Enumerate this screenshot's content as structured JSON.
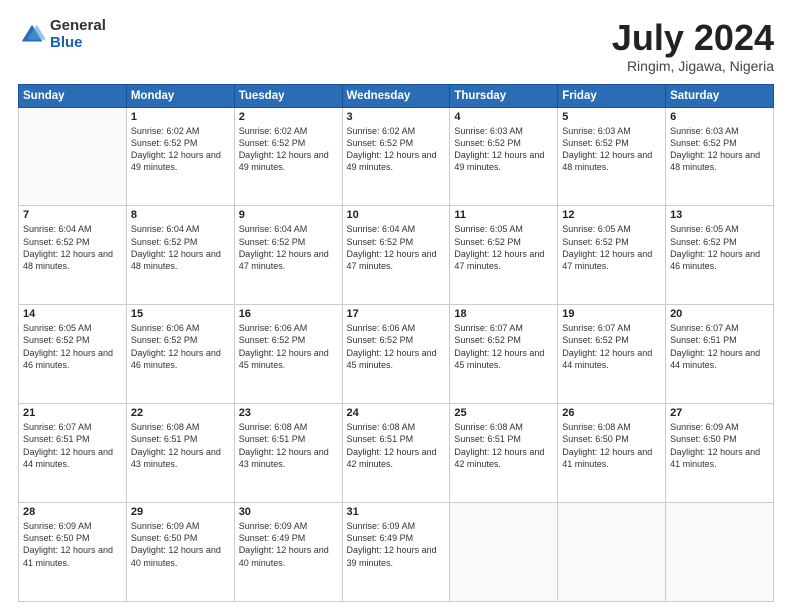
{
  "logo": {
    "general": "General",
    "blue": "Blue"
  },
  "title": "July 2024",
  "subtitle": "Ringim, Jigawa, Nigeria",
  "days_of_week": [
    "Sunday",
    "Monday",
    "Tuesday",
    "Wednesday",
    "Thursday",
    "Friday",
    "Saturday"
  ],
  "weeks": [
    [
      {
        "day": "",
        "info": ""
      },
      {
        "day": "1",
        "info": "Sunrise: 6:02 AM\nSunset: 6:52 PM\nDaylight: 12 hours and 49 minutes."
      },
      {
        "day": "2",
        "info": "Sunrise: 6:02 AM\nSunset: 6:52 PM\nDaylight: 12 hours and 49 minutes."
      },
      {
        "day": "3",
        "info": "Sunrise: 6:02 AM\nSunset: 6:52 PM\nDaylight: 12 hours and 49 minutes."
      },
      {
        "day": "4",
        "info": "Sunrise: 6:03 AM\nSunset: 6:52 PM\nDaylight: 12 hours and 49 minutes."
      },
      {
        "day": "5",
        "info": "Sunrise: 6:03 AM\nSunset: 6:52 PM\nDaylight: 12 hours and 48 minutes."
      },
      {
        "day": "6",
        "info": "Sunrise: 6:03 AM\nSunset: 6:52 PM\nDaylight: 12 hours and 48 minutes."
      }
    ],
    [
      {
        "day": "7",
        "info": "Sunrise: 6:04 AM\nSunset: 6:52 PM\nDaylight: 12 hours and 48 minutes."
      },
      {
        "day": "8",
        "info": "Sunrise: 6:04 AM\nSunset: 6:52 PM\nDaylight: 12 hours and 48 minutes."
      },
      {
        "day": "9",
        "info": "Sunrise: 6:04 AM\nSunset: 6:52 PM\nDaylight: 12 hours and 47 minutes."
      },
      {
        "day": "10",
        "info": "Sunrise: 6:04 AM\nSunset: 6:52 PM\nDaylight: 12 hours and 47 minutes."
      },
      {
        "day": "11",
        "info": "Sunrise: 6:05 AM\nSunset: 6:52 PM\nDaylight: 12 hours and 47 minutes."
      },
      {
        "day": "12",
        "info": "Sunrise: 6:05 AM\nSunset: 6:52 PM\nDaylight: 12 hours and 47 minutes."
      },
      {
        "day": "13",
        "info": "Sunrise: 6:05 AM\nSunset: 6:52 PM\nDaylight: 12 hours and 46 minutes."
      }
    ],
    [
      {
        "day": "14",
        "info": "Sunrise: 6:05 AM\nSunset: 6:52 PM\nDaylight: 12 hours and 46 minutes."
      },
      {
        "day": "15",
        "info": "Sunrise: 6:06 AM\nSunset: 6:52 PM\nDaylight: 12 hours and 46 minutes."
      },
      {
        "day": "16",
        "info": "Sunrise: 6:06 AM\nSunset: 6:52 PM\nDaylight: 12 hours and 45 minutes."
      },
      {
        "day": "17",
        "info": "Sunrise: 6:06 AM\nSunset: 6:52 PM\nDaylight: 12 hours and 45 minutes."
      },
      {
        "day": "18",
        "info": "Sunrise: 6:07 AM\nSunset: 6:52 PM\nDaylight: 12 hours and 45 minutes."
      },
      {
        "day": "19",
        "info": "Sunrise: 6:07 AM\nSunset: 6:52 PM\nDaylight: 12 hours and 44 minutes."
      },
      {
        "day": "20",
        "info": "Sunrise: 6:07 AM\nSunset: 6:51 PM\nDaylight: 12 hours and 44 minutes."
      }
    ],
    [
      {
        "day": "21",
        "info": "Sunrise: 6:07 AM\nSunset: 6:51 PM\nDaylight: 12 hours and 44 minutes."
      },
      {
        "day": "22",
        "info": "Sunrise: 6:08 AM\nSunset: 6:51 PM\nDaylight: 12 hours and 43 minutes."
      },
      {
        "day": "23",
        "info": "Sunrise: 6:08 AM\nSunset: 6:51 PM\nDaylight: 12 hours and 43 minutes."
      },
      {
        "day": "24",
        "info": "Sunrise: 6:08 AM\nSunset: 6:51 PM\nDaylight: 12 hours and 42 minutes."
      },
      {
        "day": "25",
        "info": "Sunrise: 6:08 AM\nSunset: 6:51 PM\nDaylight: 12 hours and 42 minutes."
      },
      {
        "day": "26",
        "info": "Sunrise: 6:08 AM\nSunset: 6:50 PM\nDaylight: 12 hours and 41 minutes."
      },
      {
        "day": "27",
        "info": "Sunrise: 6:09 AM\nSunset: 6:50 PM\nDaylight: 12 hours and 41 minutes."
      }
    ],
    [
      {
        "day": "28",
        "info": "Sunrise: 6:09 AM\nSunset: 6:50 PM\nDaylight: 12 hours and 41 minutes."
      },
      {
        "day": "29",
        "info": "Sunrise: 6:09 AM\nSunset: 6:50 PM\nDaylight: 12 hours and 40 minutes."
      },
      {
        "day": "30",
        "info": "Sunrise: 6:09 AM\nSunset: 6:49 PM\nDaylight: 12 hours and 40 minutes."
      },
      {
        "day": "31",
        "info": "Sunrise: 6:09 AM\nSunset: 6:49 PM\nDaylight: 12 hours and 39 minutes."
      },
      {
        "day": "",
        "info": ""
      },
      {
        "day": "",
        "info": ""
      },
      {
        "day": "",
        "info": ""
      }
    ]
  ]
}
